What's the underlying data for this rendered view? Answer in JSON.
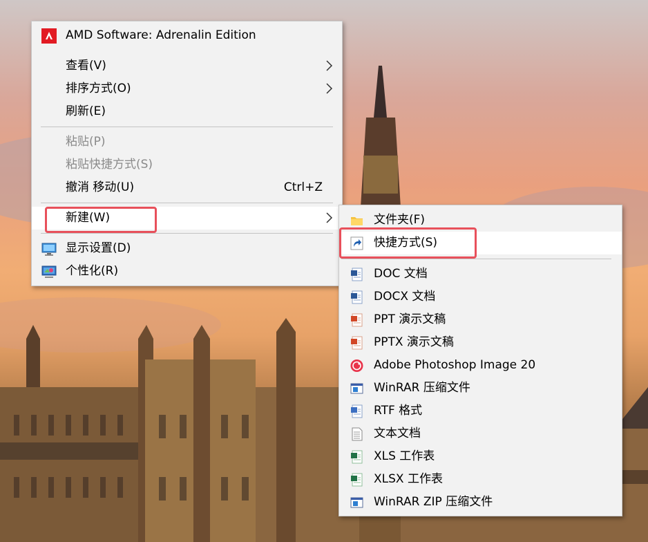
{
  "context_menu": {
    "amd": "AMD Software: Adrenalin Edition",
    "view": "查看(V)",
    "sort": "排序方式(O)",
    "refresh": "刷新(E)",
    "paste": "粘贴(P)",
    "paste_shortcut": "粘贴快捷方式(S)",
    "undo": "撤消 移动(U)",
    "undo_shortcut": "Ctrl+Z",
    "new": "新建(W)",
    "display": "显示设置(D)",
    "personalize": "个性化(R)"
  },
  "new_submenu": {
    "items": [
      {
        "label": "文件夹(F)",
        "icon": "folder-icon"
      },
      {
        "label": "快捷方式(S)",
        "icon": "shortcut-icon"
      },
      {
        "label": "DOC 文档",
        "icon": "word-doc-icon"
      },
      {
        "label": "DOCX 文档",
        "icon": "word-docx-icon"
      },
      {
        "label": "PPT 演示文稿",
        "icon": "ppt-icon"
      },
      {
        "label": "PPTX 演示文稿",
        "icon": "pptx-icon"
      },
      {
        "label": "Adobe Photoshop Image 20",
        "icon": "photoshop-icon"
      },
      {
        "label": "WinRAR 压缩文件",
        "icon": "winrar-icon"
      },
      {
        "label": "RTF 格式",
        "icon": "rtf-icon"
      },
      {
        "label": "文本文档",
        "icon": "text-file-icon"
      },
      {
        "label": "XLS 工作表",
        "icon": "xls-icon"
      },
      {
        "label": "XLSX 工作表",
        "icon": "xlsx-icon"
      },
      {
        "label": "WinRAR ZIP 压缩文件",
        "icon": "winrar-zip-icon"
      }
    ]
  },
  "colors": {
    "menu_bg": "#f2f2f2",
    "hover_bg": "#ffffff",
    "highlight_box": "#e8505b",
    "disabled_text": "#8a8a8a"
  }
}
